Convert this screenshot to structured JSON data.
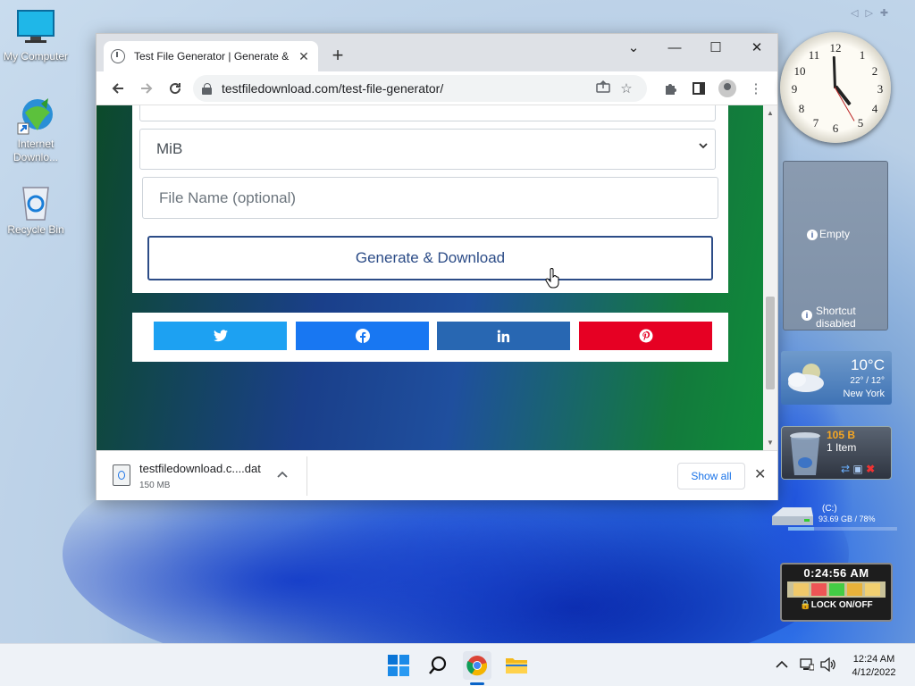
{
  "desktop": {
    "icons": [
      {
        "label": "My Computer"
      },
      {
        "label": "Internet Downlo..."
      },
      {
        "label": "Recycle Bin"
      }
    ]
  },
  "browser": {
    "tab_title": "Test File Generator | Generate &",
    "tab_close": "✕",
    "new_tab": "+",
    "window_controls": {
      "tabs_menu": "⌄",
      "minimize": "—",
      "maximize": "☐",
      "close": "✕"
    },
    "url": "testfiledownload.com/test-file-generator/",
    "page": {
      "unit_select_value": "MiB",
      "file_name_placeholder": "File Name (optional)",
      "generate_label": "Generate & Download",
      "share_buttons": [
        {
          "name": "twitter",
          "color": "#1da1f2"
        },
        {
          "name": "facebook",
          "color": "#1877f2"
        },
        {
          "name": "linkedin",
          "color": "#2867b2"
        },
        {
          "name": "pinterest",
          "color": "#e60023"
        }
      ]
    },
    "download_bar": {
      "file_name": "testfiledownload.c....dat",
      "file_size": "150 MB",
      "show_all": "Show all"
    }
  },
  "gadgets": {
    "slideshow": {
      "status": "Empty",
      "shortcut": "Shortcut disabled"
    },
    "weather": {
      "temp": "10°C",
      "range": "22° / 12°",
      "city": "New York"
    },
    "recycle": {
      "size": "105 B",
      "items": "1 Item"
    },
    "drive": {
      "label": "(C:)",
      "usage": "93.69 GB / 78%"
    },
    "timer": {
      "time": "0:24:56 AM",
      "lock": "LOCK ON/OFF"
    }
  },
  "taskbar": {
    "time": "12:24 AM",
    "date": "4/12/2022"
  }
}
